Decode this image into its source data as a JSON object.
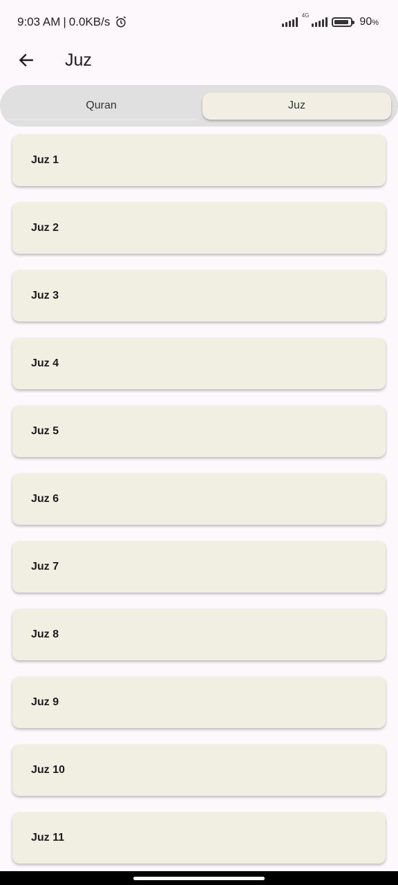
{
  "status_bar": {
    "time": "9:03 AM",
    "separator": "|",
    "net_speed": "0.0KB/s",
    "net_type": "4G",
    "battery_percent": "90",
    "battery_level": 0.9,
    "percent_sign": "%"
  },
  "app_bar": {
    "title": "Juz",
    "back_icon": "arrow-left-icon"
  },
  "tabs": [
    {
      "label": "Quran",
      "selected": false
    },
    {
      "label": "Juz",
      "selected": true
    }
  ],
  "juz_list": [
    {
      "label": "Juz 1"
    },
    {
      "label": "Juz 2"
    },
    {
      "label": "Juz 3"
    },
    {
      "label": "Juz 4"
    },
    {
      "label": "Juz 5"
    },
    {
      "label": "Juz 6"
    },
    {
      "label": "Juz 7"
    },
    {
      "label": "Juz 8"
    },
    {
      "label": "Juz 9"
    },
    {
      "label": "Juz 10"
    },
    {
      "label": "Juz 11"
    }
  ],
  "colors": {
    "background": "#fdf8fc",
    "card": "#f1eee2",
    "segment_track": "#e0e0e0",
    "segment_selected": "#f2eee3"
  }
}
